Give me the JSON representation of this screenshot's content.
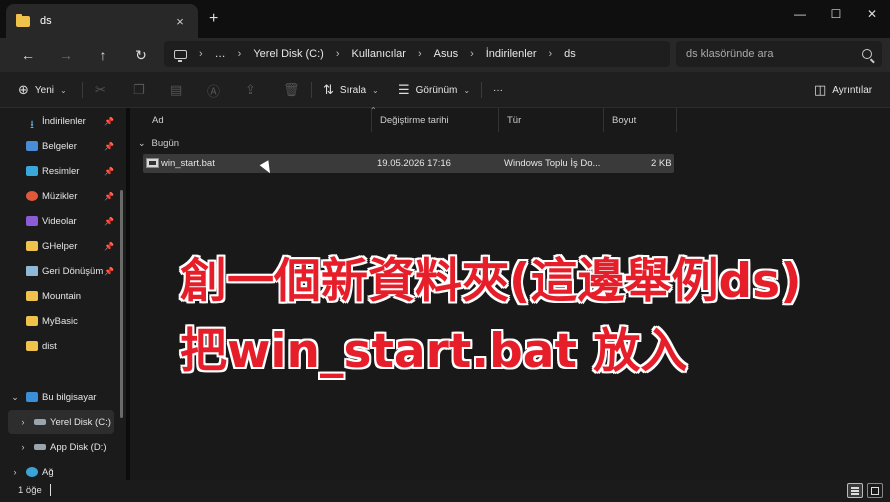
{
  "window": {
    "tab_title": "ds",
    "tab_close": "×",
    "new_tab": "+",
    "min": "—",
    "max": "☐",
    "close": "✕"
  },
  "nav": {
    "back": "←",
    "forward": "→",
    "up": "↑",
    "refresh": "↻",
    "more": "…",
    "breadcrumbs": [
      "Yerel Disk (C:)",
      "Kullanıcılar",
      "Asus",
      "İndirilenler",
      "ds"
    ],
    "search_placeholder": "ds klasöründe ara"
  },
  "toolbar": {
    "new_label": "Yeni",
    "sort_label": "Sırala",
    "view_label": "Görünüm",
    "more_label": "···",
    "details_label": "Ayrıntılar",
    "icons": [
      "cut-icon",
      "copy-icon",
      "paste-icon",
      "rename-icon",
      "share-icon",
      "delete-icon"
    ]
  },
  "sidebar": {
    "items": [
      {
        "label": "İndirilenler",
        "icon": "download-icon",
        "pinned": true
      },
      {
        "label": "Belgeler",
        "icon": "documents-icon",
        "pinned": true
      },
      {
        "label": "Resimler",
        "icon": "pictures-icon",
        "pinned": true
      },
      {
        "label": "Müzikler",
        "icon": "music-icon",
        "pinned": true
      },
      {
        "label": "Videolar",
        "icon": "videos-icon",
        "pinned": true
      },
      {
        "label": "GHelper",
        "icon": "folder-icon",
        "pinned": true
      },
      {
        "label": "Geri Dönüşüm",
        "icon": "recycle-bin-icon",
        "pinned": true
      },
      {
        "label": "Mountain",
        "icon": "folder-icon",
        "pinned": false
      },
      {
        "label": "MyBasic",
        "icon": "folder-icon",
        "pinned": false
      },
      {
        "label": "dist",
        "icon": "folder-icon",
        "pinned": false
      }
    ],
    "this_pc": "Bu bilgisayar",
    "drive_c": "Yerel Disk (C:)",
    "drive_d": "App Disk (D:)",
    "network": "Ağ"
  },
  "columns": {
    "name": "Ad",
    "modified": "Değiştirme tarihi",
    "type": "Tür",
    "size": "Boyut"
  },
  "group_label": "Bugün",
  "files": [
    {
      "name": "win_start.bat",
      "modified": "19.05.2026 17:16",
      "type": "Windows Toplu İş Do...",
      "size": "2 KB"
    }
  ],
  "overlay": {
    "line1": "創一個新資料夾(這邊舉例ds)",
    "line2": "把win_start.bat 放入"
  },
  "status": {
    "count": "1 öğe"
  },
  "colors": {
    "accent_folder": "#f0c24b",
    "caption_red": "#e51e2a"
  }
}
